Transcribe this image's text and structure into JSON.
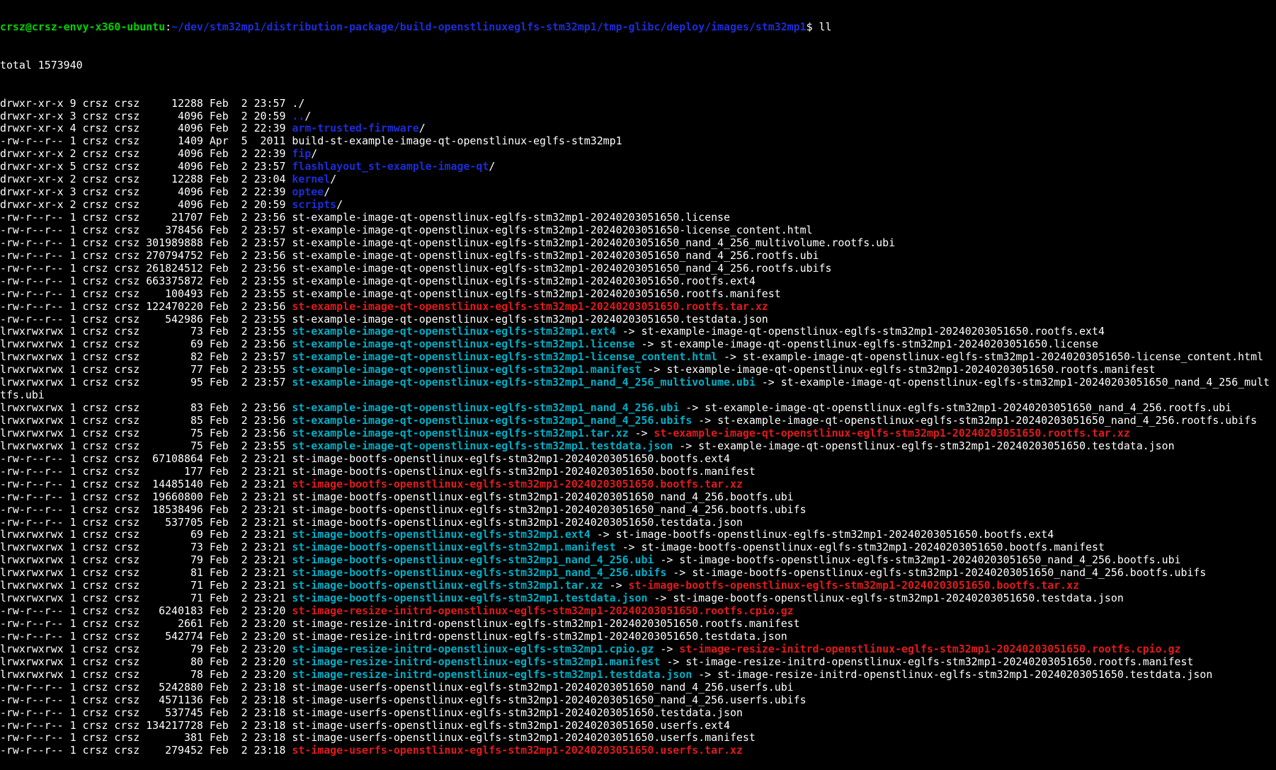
{
  "prompt": {
    "user_host": "crsz@crsz-envy-x360-ubuntu",
    "separator": ":",
    "path": "~/dev/stm32mp1/distribution-package/build-openstlinuxeglfs-stm32mp1/tmp-glibc/deploy/images/stm32mp1",
    "symbol": "$ ",
    "command": "ll"
  },
  "total_line": "total 1573940",
  "colors": {
    "background": "#000000",
    "text": "#ffffff",
    "user_host": "#00d300",
    "directory": "#1c2dd6",
    "symlink": "#00afc8",
    "archive": "#e21b1b"
  },
  "listing": [
    {
      "meta": "drwxr-xr-x 9 crsz crsz     12288 Feb  2 23:57 ",
      "name": ".",
      "kind": "n",
      "suffix": "/"
    },
    {
      "meta": "drwxr-xr-x 3 crsz crsz      4096 Feb  2 20:59 ",
      "name": "..",
      "kind": "d",
      "suffix": "/"
    },
    {
      "meta": "drwxr-xr-x 4 crsz crsz      4096 Feb  2 22:39 ",
      "name": "arm-trusted-firmware",
      "kind": "d",
      "suffix": "/"
    },
    {
      "meta": "-rw-r--r-- 1 crsz crsz      1409 Apr  5  2011 ",
      "name": "build-st-example-image-qt-openstlinux-eglfs-stm32mp1",
      "kind": "n",
      "suffix": ""
    },
    {
      "meta": "drwxr-xr-x 2 crsz crsz      4096 Feb  2 22:39 ",
      "name": "fip",
      "kind": "d",
      "suffix": "/"
    },
    {
      "meta": "drwxr-xr-x 5 crsz crsz      4096 Feb  2 23:57 ",
      "name": "flashlayout_st-example-image-qt",
      "kind": "d",
      "suffix": "/"
    },
    {
      "meta": "drwxr-xr-x 2 crsz crsz     12288 Feb  2 23:04 ",
      "name": "kernel",
      "kind": "d",
      "suffix": "/"
    },
    {
      "meta": "drwxr-xr-x 3 crsz crsz      4096 Feb  2 22:39 ",
      "name": "optee",
      "kind": "d",
      "suffix": "/"
    },
    {
      "meta": "drwxr-xr-x 2 crsz crsz      4096 Feb  2 20:59 ",
      "name": "scripts",
      "kind": "d",
      "suffix": "/"
    },
    {
      "meta": "-rw-r--r-- 1 crsz crsz     21707 Feb  2 23:56 ",
      "name": "st-example-image-qt-openstlinux-eglfs-stm32mp1-20240203051650.license",
      "kind": "n",
      "suffix": ""
    },
    {
      "meta": "-rw-r--r-- 1 crsz crsz    378456 Feb  2 23:57 ",
      "name": "st-example-image-qt-openstlinux-eglfs-stm32mp1-20240203051650-license_content.html",
      "kind": "n",
      "suffix": ""
    },
    {
      "meta": "-rw-r--r-- 1 crsz crsz 301989888 Feb  2 23:57 ",
      "name": "st-example-image-qt-openstlinux-eglfs-stm32mp1-20240203051650_nand_4_256_multivolume.rootfs.ubi",
      "kind": "n",
      "suffix": ""
    },
    {
      "meta": "-rw-r--r-- 1 crsz crsz 270794752 Feb  2 23:56 ",
      "name": "st-example-image-qt-openstlinux-eglfs-stm32mp1-20240203051650_nand_4_256.rootfs.ubi",
      "kind": "n",
      "suffix": ""
    },
    {
      "meta": "-rw-r--r-- 1 crsz crsz 261824512 Feb  2 23:56 ",
      "name": "st-example-image-qt-openstlinux-eglfs-stm32mp1-20240203051650_nand_4_256.rootfs.ubifs",
      "kind": "n",
      "suffix": ""
    },
    {
      "meta": "-rw-r--r-- 1 crsz crsz 663375872 Feb  2 23:55 ",
      "name": "st-example-image-qt-openstlinux-eglfs-stm32mp1-20240203051650.rootfs.ext4",
      "kind": "n",
      "suffix": ""
    },
    {
      "meta": "-rw-r--r-- 1 crsz crsz    100493 Feb  2 23:55 ",
      "name": "st-example-image-qt-openstlinux-eglfs-stm32mp1-20240203051650.rootfs.manifest",
      "kind": "n",
      "suffix": ""
    },
    {
      "meta": "-rw-r--r-- 1 crsz crsz 122470220 Feb  2 23:56 ",
      "name": "st-example-image-qt-openstlinux-eglfs-stm32mp1-20240203051650.rootfs.tar.xz",
      "kind": "r",
      "suffix": ""
    },
    {
      "meta": "-rw-r--r-- 1 crsz crsz    542986 Feb  2 23:55 ",
      "name": "st-example-image-qt-openstlinux-eglfs-stm32mp1-20240203051650.testdata.json",
      "kind": "n",
      "suffix": ""
    },
    {
      "meta": "lrwxrwxrwx 1 crsz crsz        73 Feb  2 23:55 ",
      "name": "st-example-image-qt-openstlinux-eglfs-stm32mp1.ext4",
      "kind": "l",
      "arrow": " -> ",
      "target": "st-example-image-qt-openstlinux-eglfs-stm32mp1-20240203051650.rootfs.ext4",
      "target_kind": "n"
    },
    {
      "meta": "lrwxrwxrwx 1 crsz crsz        69 Feb  2 23:56 ",
      "name": "st-example-image-qt-openstlinux-eglfs-stm32mp1.license",
      "kind": "l",
      "arrow": " -> ",
      "target": "st-example-image-qt-openstlinux-eglfs-stm32mp1-20240203051650.license",
      "target_kind": "n"
    },
    {
      "meta": "lrwxrwxrwx 1 crsz crsz        82 Feb  2 23:57 ",
      "name": "st-example-image-qt-openstlinux-eglfs-stm32mp1-license_content.html",
      "kind": "l",
      "arrow": " -> ",
      "target": "st-example-image-qt-openstlinux-eglfs-stm32mp1-20240203051650-license_content.html",
      "target_kind": "n"
    },
    {
      "meta": "lrwxrwxrwx 1 crsz crsz        77 Feb  2 23:55 ",
      "name": "st-example-image-qt-openstlinux-eglfs-stm32mp1.manifest",
      "kind": "l",
      "arrow": " -> ",
      "target": "st-example-image-qt-openstlinux-eglfs-stm32mp1-20240203051650.rootfs.manifest",
      "target_kind": "n"
    },
    {
      "meta": "lrwxrwxrwx 1 crsz crsz        95 Feb  2 23:57 ",
      "name": "st-example-image-qt-openstlinux-eglfs-stm32mp1_nand_4_256_multivolume.ubi",
      "kind": "l",
      "arrow": " -> ",
      "target": "st-example-image-qt-openstlinux-eglfs-stm32mp1-20240203051650_nand_4_256_mult",
      "target_kind": "n"
    },
    {
      "meta": "",
      "name": "tfs.ubi",
      "kind": "n",
      "suffix": ""
    },
    {
      "meta": "lrwxrwxrwx 1 crsz crsz        83 Feb  2 23:56 ",
      "name": "st-example-image-qt-openstlinux-eglfs-stm32mp1_nand_4_256.ubi",
      "kind": "l",
      "arrow": " -> ",
      "target": "st-example-image-qt-openstlinux-eglfs-stm32mp1-20240203051650_nand_4_256.rootfs.ubi",
      "target_kind": "n"
    },
    {
      "meta": "lrwxrwxrwx 1 crsz crsz        85 Feb  2 23:56 ",
      "name": "st-example-image-qt-openstlinux-eglfs-stm32mp1_nand_4_256.ubifs",
      "kind": "l",
      "arrow": " -> ",
      "target": "st-example-image-qt-openstlinux-eglfs-stm32mp1-20240203051650_nand_4_256.rootfs.ubifs",
      "target_kind": "n"
    },
    {
      "meta": "lrwxrwxrwx 1 crsz crsz        75 Feb  2 23:56 ",
      "name": "st-example-image-qt-openstlinux-eglfs-stm32mp1.tar.xz",
      "kind": "l",
      "arrow": " -> ",
      "target": "st-example-image-qt-openstlinux-eglfs-stm32mp1-20240203051650.rootfs.tar.xz",
      "target_kind": "r"
    },
    {
      "meta": "lrwxrwxrwx 1 crsz crsz        75 Feb  2 23:55 ",
      "name": "st-example-image-qt-openstlinux-eglfs-stm32mp1.testdata.json",
      "kind": "l",
      "arrow": " -> ",
      "target": "st-example-image-qt-openstlinux-eglfs-stm32mp1-20240203051650.testdata.json",
      "target_kind": "n"
    },
    {
      "meta": "-rw-r--r-- 1 crsz crsz  67108864 Feb  2 23:21 ",
      "name": "st-image-bootfs-openstlinux-eglfs-stm32mp1-20240203051650.bootfs.ext4",
      "kind": "n",
      "suffix": ""
    },
    {
      "meta": "-rw-r--r-- 1 crsz crsz       177 Feb  2 23:21 ",
      "name": "st-image-bootfs-openstlinux-eglfs-stm32mp1-20240203051650.bootfs.manifest",
      "kind": "n",
      "suffix": ""
    },
    {
      "meta": "-rw-r--r-- 1 crsz crsz  14485140 Feb  2 23:21 ",
      "name": "st-image-bootfs-openstlinux-eglfs-stm32mp1-20240203051650.bootfs.tar.xz",
      "kind": "r",
      "suffix": ""
    },
    {
      "meta": "-rw-r--r-- 1 crsz crsz  19660800 Feb  2 23:21 ",
      "name": "st-image-bootfs-openstlinux-eglfs-stm32mp1-20240203051650_nand_4_256.bootfs.ubi",
      "kind": "n",
      "suffix": ""
    },
    {
      "meta": "-rw-r--r-- 1 crsz crsz  18538496 Feb  2 23:21 ",
      "name": "st-image-bootfs-openstlinux-eglfs-stm32mp1-20240203051650_nand_4_256.bootfs.ubifs",
      "kind": "n",
      "suffix": ""
    },
    {
      "meta": "-rw-r--r-- 1 crsz crsz    537705 Feb  2 23:21 ",
      "name": "st-image-bootfs-openstlinux-eglfs-stm32mp1-20240203051650.testdata.json",
      "kind": "n",
      "suffix": ""
    },
    {
      "meta": "lrwxrwxrwx 1 crsz crsz        69 Feb  2 23:21 ",
      "name": "st-image-bootfs-openstlinux-eglfs-stm32mp1.ext4",
      "kind": "l",
      "arrow": " -> ",
      "target": "st-image-bootfs-openstlinux-eglfs-stm32mp1-20240203051650.bootfs.ext4",
      "target_kind": "n"
    },
    {
      "meta": "lrwxrwxrwx 1 crsz crsz        73 Feb  2 23:21 ",
      "name": "st-image-bootfs-openstlinux-eglfs-stm32mp1.manifest",
      "kind": "l",
      "arrow": " -> ",
      "target": "st-image-bootfs-openstlinux-eglfs-stm32mp1-20240203051650.bootfs.manifest",
      "target_kind": "n"
    },
    {
      "meta": "lrwxrwxrwx 1 crsz crsz        79 Feb  2 23:21 ",
      "name": "st-image-bootfs-openstlinux-eglfs-stm32mp1_nand_4_256.ubi",
      "kind": "l",
      "arrow": " -> ",
      "target": "st-image-bootfs-openstlinux-eglfs-stm32mp1-20240203051650_nand_4_256.bootfs.ubi",
      "target_kind": "n"
    },
    {
      "meta": "lrwxrwxrwx 1 crsz crsz        81 Feb  2 23:21 ",
      "name": "st-image-bootfs-openstlinux-eglfs-stm32mp1_nand_4_256.ubifs",
      "kind": "l",
      "arrow": " -> ",
      "target": "st-image-bootfs-openstlinux-eglfs-stm32mp1-20240203051650_nand_4_256.bootfs.ubifs",
      "target_kind": "n"
    },
    {
      "meta": "lrwxrwxrwx 1 crsz crsz        71 Feb  2 23:21 ",
      "name": "st-image-bootfs-openstlinux-eglfs-stm32mp1.tar.xz",
      "kind": "l",
      "arrow": " -> ",
      "target": "st-image-bootfs-openstlinux-eglfs-stm32mp1-20240203051650.bootfs.tar.xz",
      "target_kind": "r"
    },
    {
      "meta": "lrwxrwxrwx 1 crsz crsz        71 Feb  2 23:21 ",
      "name": "st-image-bootfs-openstlinux-eglfs-stm32mp1.testdata.json",
      "kind": "l",
      "arrow": " -> ",
      "target": "st-image-bootfs-openstlinux-eglfs-stm32mp1-20240203051650.testdata.json",
      "target_kind": "n"
    },
    {
      "meta": "-rw-r--r-- 1 crsz crsz   6240183 Feb  2 23:20 ",
      "name": "st-image-resize-initrd-openstlinux-eglfs-stm32mp1-20240203051650.rootfs.cpio.gz",
      "kind": "r",
      "suffix": ""
    },
    {
      "meta": "-rw-r--r-- 1 crsz crsz      2661 Feb  2 23:20 ",
      "name": "st-image-resize-initrd-openstlinux-eglfs-stm32mp1-20240203051650.rootfs.manifest",
      "kind": "n",
      "suffix": ""
    },
    {
      "meta": "-rw-r--r-- 1 crsz crsz    542774 Feb  2 23:20 ",
      "name": "st-image-resize-initrd-openstlinux-eglfs-stm32mp1-20240203051650.testdata.json",
      "kind": "n",
      "suffix": ""
    },
    {
      "meta": "lrwxrwxrwx 1 crsz crsz        79 Feb  2 23:20 ",
      "name": "st-image-resize-initrd-openstlinux-eglfs-stm32mp1.cpio.gz",
      "kind": "l",
      "arrow": " -> ",
      "target": "st-image-resize-initrd-openstlinux-eglfs-stm32mp1-20240203051650.rootfs.cpio.gz",
      "target_kind": "r"
    },
    {
      "meta": "lrwxrwxrwx 1 crsz crsz        80 Feb  2 23:20 ",
      "name": "st-image-resize-initrd-openstlinux-eglfs-stm32mp1.manifest",
      "kind": "l",
      "arrow": " -> ",
      "target": "st-image-resize-initrd-openstlinux-eglfs-stm32mp1-20240203051650.rootfs.manifest",
      "target_kind": "n"
    },
    {
      "meta": "lrwxrwxrwx 1 crsz crsz        78 Feb  2 23:20 ",
      "name": "st-image-resize-initrd-openstlinux-eglfs-stm32mp1.testdata.json",
      "kind": "l",
      "arrow": " -> ",
      "target": "st-image-resize-initrd-openstlinux-eglfs-stm32mp1-20240203051650.testdata.json",
      "target_kind": "n"
    },
    {
      "meta": "-rw-r--r-- 1 crsz crsz   5242880 Feb  2 23:18 ",
      "name": "st-image-userfs-openstlinux-eglfs-stm32mp1-20240203051650_nand_4_256.userfs.ubi",
      "kind": "n",
      "suffix": ""
    },
    {
      "meta": "-rw-r--r-- 1 crsz crsz   4571136 Feb  2 23:18 ",
      "name": "st-image-userfs-openstlinux-eglfs-stm32mp1-20240203051650_nand_4_256.userfs.ubifs",
      "kind": "n",
      "suffix": ""
    },
    {
      "meta": "-rw-r--r-- 1 crsz crsz    537745 Feb  2 23:18 ",
      "name": "st-image-userfs-openstlinux-eglfs-stm32mp1-20240203051650.testdata.json",
      "kind": "n",
      "suffix": ""
    },
    {
      "meta": "-rw-r--r-- 1 crsz crsz 134217728 Feb  2 23:18 ",
      "name": "st-image-userfs-openstlinux-eglfs-stm32mp1-20240203051650.userfs.ext4",
      "kind": "n",
      "suffix": ""
    },
    {
      "meta": "-rw-r--r-- 1 crsz crsz       381 Feb  2 23:18 ",
      "name": "st-image-userfs-openstlinux-eglfs-stm32mp1-20240203051650.userfs.manifest",
      "kind": "n",
      "suffix": ""
    },
    {
      "meta": "-rw-r--r-- 1 crsz crsz    279452 Feb  2 23:18 ",
      "name": "st-image-userfs-openstlinux-eglfs-stm32mp1-20240203051650.userfs.tar.xz",
      "kind": "r",
      "suffix": ""
    }
  ]
}
